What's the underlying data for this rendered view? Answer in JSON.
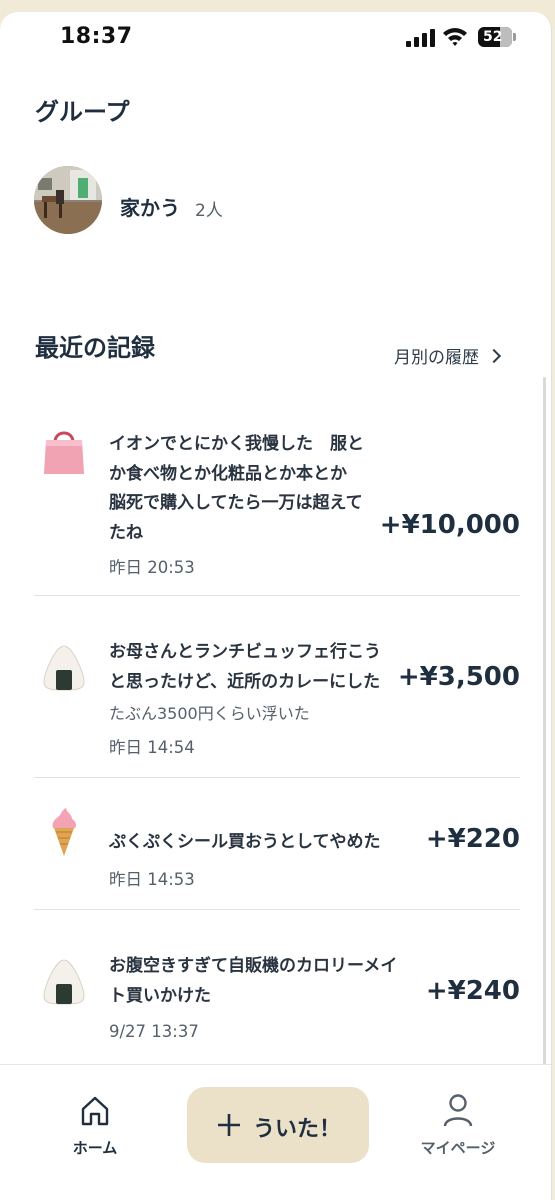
{
  "status_bar": {
    "time": "18:37",
    "battery": "52"
  },
  "groups_section": {
    "title": "グループ",
    "group": {
      "name": "家かう",
      "member_count": "2人"
    }
  },
  "recent_section": {
    "title": "最近の記録",
    "monthly_link": "月別の履歴"
  },
  "records": [
    {
      "icon": "shopping-bag-icon",
      "title_lines": [
        "イオンでとにかく我慢した　服と",
        "か食べ物とか化粧品とか本とか",
        "脳死で購入してたら一万は超えて",
        "たね"
      ],
      "note": "",
      "time": "昨日 20:53",
      "amount": "+¥10,000"
    },
    {
      "icon": "onigiri-icon",
      "title_lines": [
        "お母さんとランチビュッフェ行こう",
        "と思ったけど、近所のカレーにした"
      ],
      "note": "たぶん3500円くらい浮いた",
      "time": "昨日 14:54",
      "amount": "+¥3,500"
    },
    {
      "icon": "soft-serve-icon",
      "title_lines": [
        "ぷくぷくシール買おうとしてやめた"
      ],
      "note": "",
      "time": "昨日 14:53",
      "amount": "+¥220"
    },
    {
      "icon": "onigiri-icon",
      "title_lines": [
        "お腹空きすぎて自販機のカロリーメイ",
        "ト買いかけた"
      ],
      "note": "",
      "time": "9/27 13:37",
      "amount": "+¥240"
    }
  ],
  "bottom_nav": {
    "home": "ホーム",
    "add": "ういた！",
    "mypage": "マイページ"
  },
  "colors": {
    "accent_button": "#ebe1c9",
    "text_primary": "#1f2f40",
    "background_top": "#f3ecdb"
  }
}
